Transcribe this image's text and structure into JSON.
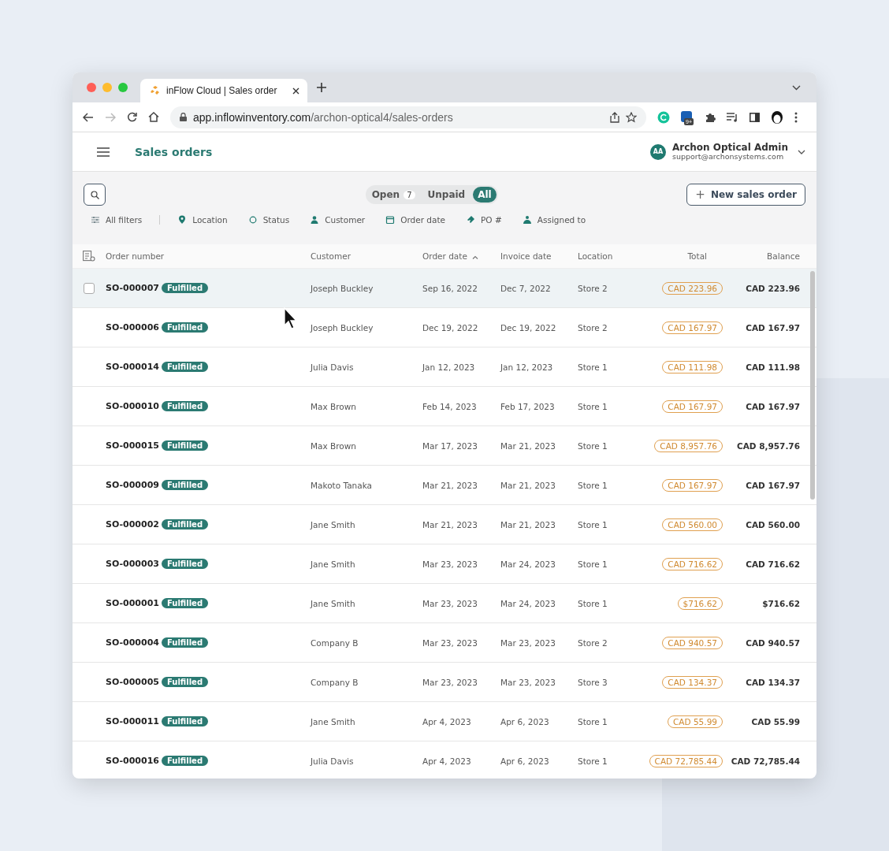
{
  "browser": {
    "tab_title": "inFlow Cloud | Sales order",
    "url_host": "app.inflowinventory.com",
    "url_path": "/archon-optical4/sales-orders",
    "extension_badge": "9+"
  },
  "app": {
    "title": "Sales orders",
    "user": {
      "initials": "AA",
      "name": "Archon Optical Admin",
      "email": "support@archonsystems.com"
    }
  },
  "views": [
    {
      "label": "Open",
      "count": "7",
      "selected": false
    },
    {
      "label": "Unpaid",
      "selected": false
    },
    {
      "label": "All",
      "selected": true
    }
  ],
  "new_button": {
    "icon": "+",
    "label": "New sales order"
  },
  "filters": [
    {
      "kind": "sliders",
      "label": "All filters"
    },
    {
      "kind": "pin",
      "label": "Location"
    },
    {
      "kind": "circle",
      "label": "Status"
    },
    {
      "kind": "person",
      "label": "Customer"
    },
    {
      "kind": "calendar",
      "label": "Order date"
    },
    {
      "kind": "tag",
      "label": "PO #"
    },
    {
      "kind": "people",
      "label": "Assigned to"
    }
  ],
  "table": {
    "columns": [
      {
        "label": "Order number",
        "sorted": false
      },
      {
        "label": "Customer",
        "sorted": false
      },
      {
        "label": "Order date",
        "sorted": true
      },
      {
        "label": "Invoice date",
        "sorted": false
      },
      {
        "label": "Location",
        "sorted": false
      },
      {
        "label": "Total",
        "sorted": false
      },
      {
        "label": "Balance",
        "sorted": false
      }
    ],
    "rows": [
      {
        "order_number": "SO-000007",
        "status": "Fulfilled",
        "customer": "Joseph Buckley",
        "order_date": "Sep 16, 2022",
        "invoice_date": "Dec 7, 2022",
        "location": "Store 2",
        "total": "CAD 223.96",
        "balance": "CAD 223.96",
        "hovered": true
      },
      {
        "order_number": "SO-000006",
        "status": "Fulfilled",
        "customer": "Joseph Buckley",
        "order_date": "Dec 19, 2022",
        "invoice_date": "Dec 19, 2022",
        "location": "Store 2",
        "total": "CAD 167.97",
        "balance": "CAD 167.97",
        "hovered": false
      },
      {
        "order_number": "SO-000014",
        "status": "Fulfilled",
        "customer": "Julia Davis",
        "order_date": "Jan 12, 2023",
        "invoice_date": "Jan 12, 2023",
        "location": "Store 1",
        "total": "CAD 111.98",
        "balance": "CAD 111.98",
        "hovered": false
      },
      {
        "order_number": "SO-000010",
        "status": "Fulfilled",
        "customer": "Max Brown",
        "order_date": "Feb 14, 2023",
        "invoice_date": "Feb 17, 2023",
        "location": "Store 1",
        "total": "CAD 167.97",
        "balance": "CAD 167.97",
        "hovered": false
      },
      {
        "order_number": "SO-000015",
        "status": "Fulfilled",
        "customer": "Max Brown",
        "order_date": "Mar 17, 2023",
        "invoice_date": "Mar 21, 2023",
        "location": "Store 1",
        "total": "CAD 8,957.76",
        "balance": "CAD 8,957.76",
        "hovered": false
      },
      {
        "order_number": "SO-000009",
        "status": "Fulfilled",
        "customer": "Makoto Tanaka",
        "order_date": "Mar 21, 2023",
        "invoice_date": "Mar 21, 2023",
        "location": "Store 1",
        "total": "CAD 167.97",
        "balance": "CAD 167.97",
        "hovered": false
      },
      {
        "order_number": "SO-000002",
        "status": "Fulfilled",
        "customer": "Jane Smith",
        "order_date": "Mar 21, 2023",
        "invoice_date": "Mar 21, 2023",
        "location": "Store 1",
        "total": "CAD 560.00",
        "balance": "CAD 560.00",
        "hovered": false
      },
      {
        "order_number": "SO-000003",
        "status": "Fulfilled",
        "customer": "Jane Smith",
        "order_date": "Mar 23, 2023",
        "invoice_date": "Mar 24, 2023",
        "location": "Store 1",
        "total": "CAD 716.62",
        "balance": "CAD 716.62",
        "hovered": false
      },
      {
        "order_number": "SO-000001",
        "status": "Fulfilled",
        "customer": "Jane Smith",
        "order_date": "Mar 23, 2023",
        "invoice_date": "Mar 24, 2023",
        "location": "Store 1",
        "total": "$716.62",
        "balance": "$716.62",
        "hovered": false
      },
      {
        "order_number": "SO-000004",
        "status": "Fulfilled",
        "customer": "Company B",
        "order_date": "Mar 23, 2023",
        "invoice_date": "Mar 23, 2023",
        "location": "Store 2",
        "total": "CAD 940.57",
        "balance": "CAD 940.57",
        "hovered": false
      },
      {
        "order_number": "SO-000005",
        "status": "Fulfilled",
        "customer": "Company B",
        "order_date": "Mar 23, 2023",
        "invoice_date": "Mar 23, 2023",
        "location": "Store 3",
        "total": "CAD 134.37",
        "balance": "CAD 134.37",
        "hovered": false
      },
      {
        "order_number": "SO-000011",
        "status": "Fulfilled",
        "customer": "Jane Smith",
        "order_date": "Apr 4, 2023",
        "invoice_date": "Apr 6, 2023",
        "location": "Store 1",
        "total": "CAD 55.99",
        "balance": "CAD 55.99",
        "hovered": false
      },
      {
        "order_number": "SO-000016",
        "status": "Fulfilled",
        "customer": "Julia Davis",
        "order_date": "Apr 4, 2023",
        "invoice_date": "Apr 6, 2023",
        "location": "Store 1",
        "total": "CAD 72,785.44",
        "balance": "CAD 72,785.44",
        "hovered": false
      }
    ]
  }
}
